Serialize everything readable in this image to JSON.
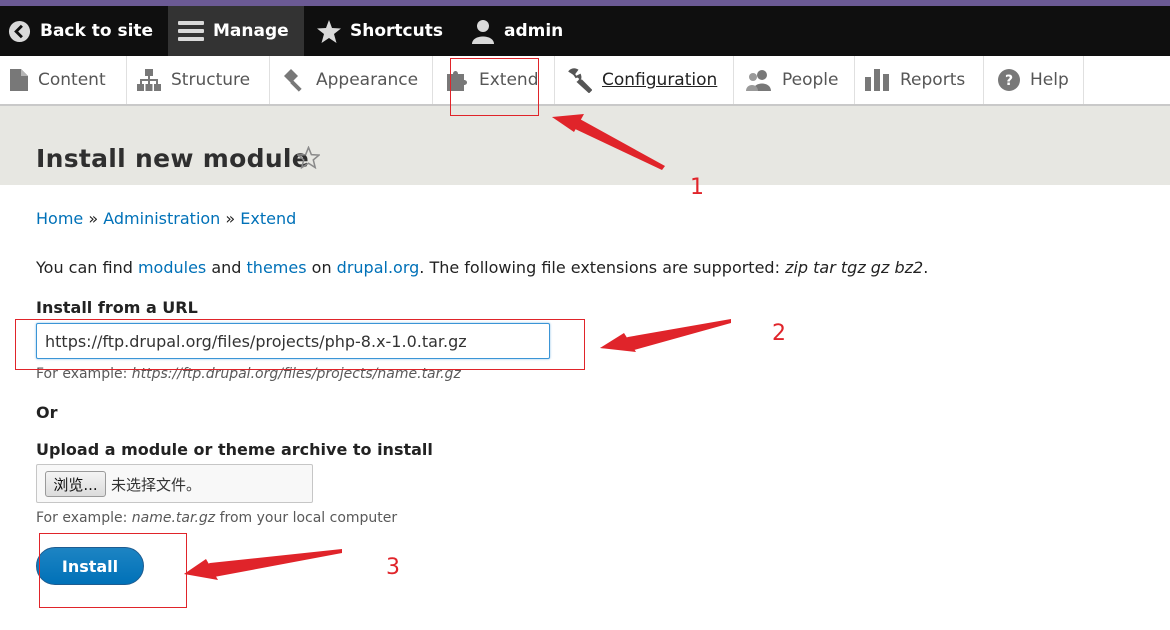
{
  "toolbar": {
    "back_label": "Back to site",
    "manage_label": "Manage",
    "shortcuts_label": "Shortcuts",
    "user_label": "admin"
  },
  "tray": {
    "items": [
      {
        "label": "Content",
        "icon": "page-icon"
      },
      {
        "label": "Structure",
        "icon": "sitemap-icon"
      },
      {
        "label": "Appearance",
        "icon": "paint-icon"
      },
      {
        "label": "Extend",
        "icon": "puzzle-icon"
      },
      {
        "label": "Configuration",
        "icon": "wrench-icon"
      },
      {
        "label": "People",
        "icon": "people-icon"
      },
      {
        "label": "Reports",
        "icon": "bar-chart-icon"
      },
      {
        "label": "Help",
        "icon": "help-icon"
      }
    ]
  },
  "page": {
    "title": "Install new module"
  },
  "breadcrumb": {
    "home": "Home",
    "sep": "»",
    "administration": "Administration",
    "extend": "Extend"
  },
  "intro": {
    "prefix": "You can find ",
    "modules": "modules",
    "and": " and ",
    "themes": "themes",
    "on": " on ",
    "drupal": "drupal.org",
    "suffix": ". The following file extensions are supported: ",
    "extensions": "zip tar tgz gz bz2",
    "end": "."
  },
  "form": {
    "url_label": "Install from a URL",
    "url_value": "https://ftp.drupal.org/files/projects/php-8.x-1.0.tar.gz",
    "url_hint_prefix": "For example: ",
    "url_hint_example": "https://ftp.drupal.org/files/projects/name.tar.gz",
    "or_label": "Or",
    "upload_label": "Upload a module or theme archive to install",
    "browse_label": "浏览...",
    "no_file_label": "未选择文件。",
    "upload_hint_prefix": "For example: ",
    "upload_hint_example": "name.tar.gz",
    "upload_hint_suffix": " from your local computer",
    "install_label": "Install"
  },
  "annotations": {
    "n1": "1",
    "n2": "2",
    "n3": "3"
  },
  "colors": {
    "toolbar_bg": "#0f0f0f",
    "link": "#0071b8",
    "annotation": "#e0242a",
    "install_button": "#0071b8"
  }
}
